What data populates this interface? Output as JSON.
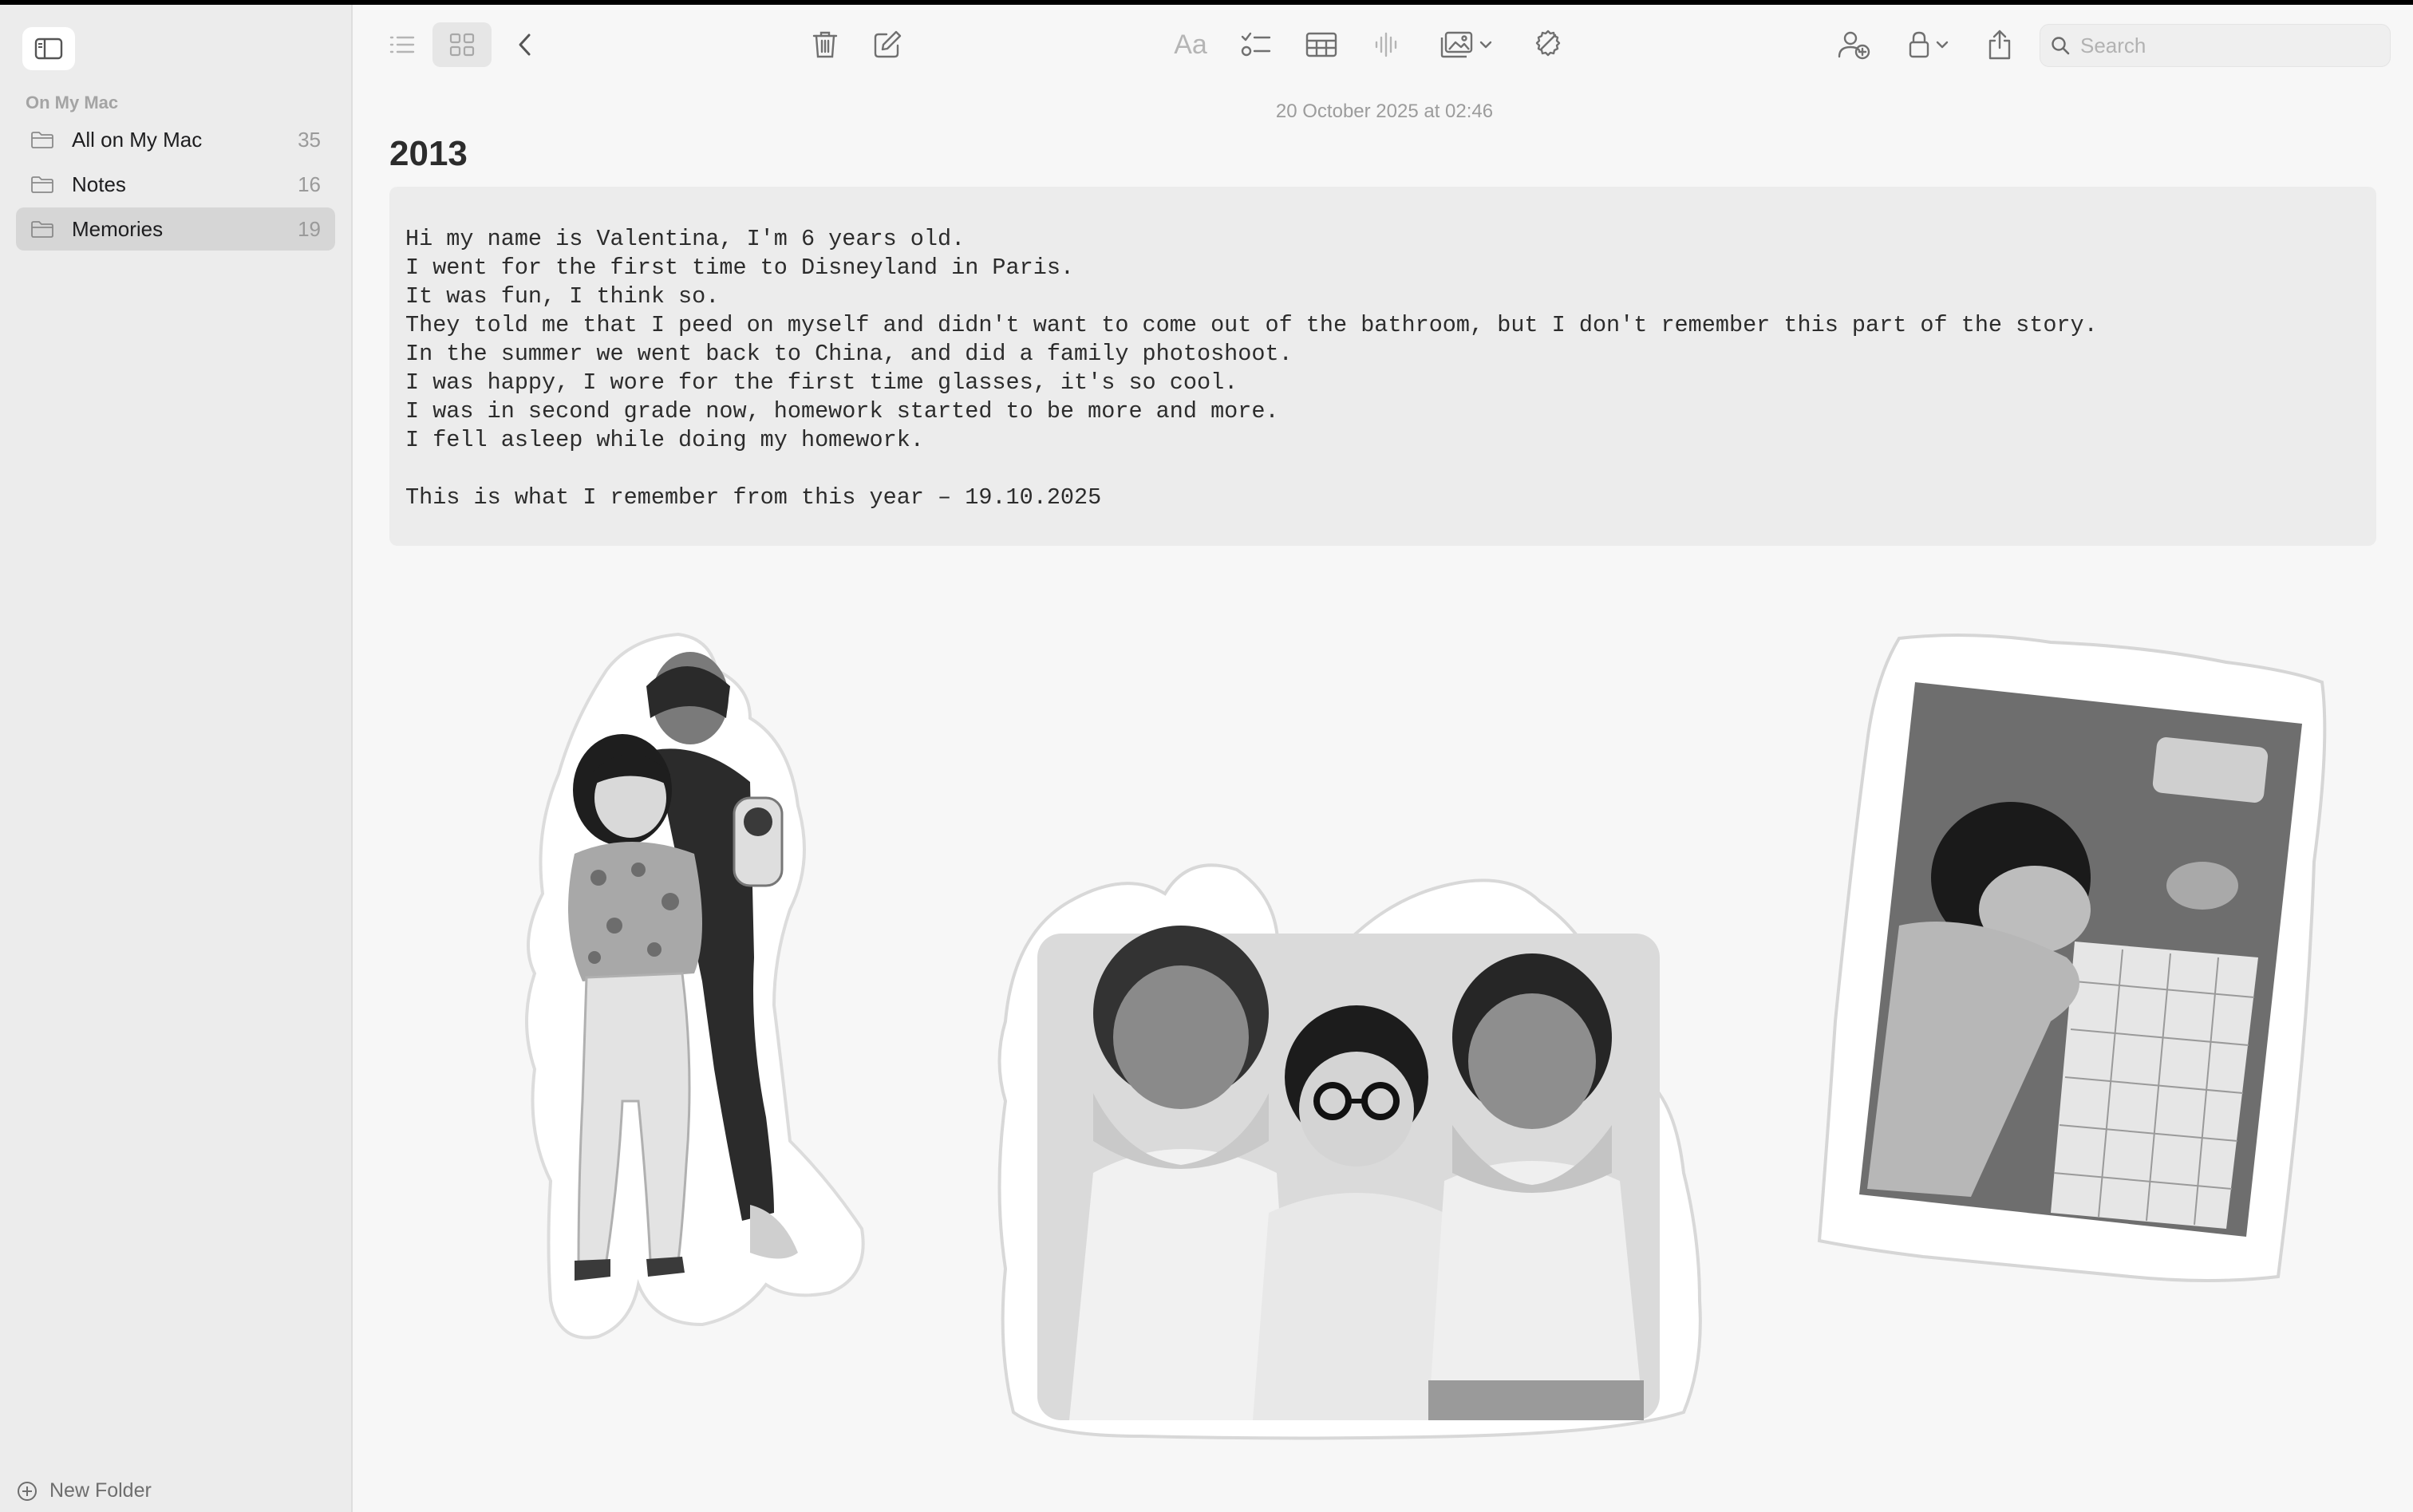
{
  "sidebar": {
    "section_title": "On My Mac",
    "folders": [
      {
        "name": "All on My Mac",
        "count": "35",
        "selected": false
      },
      {
        "name": "Notes",
        "count": "16",
        "selected": false
      },
      {
        "name": "Memories",
        "count": "19",
        "selected": true
      }
    ],
    "new_folder_label": "New Folder"
  },
  "toolbar": {
    "icons": [
      "sidebar-toggle-icon",
      "list-view-icon",
      "gallery-view-icon",
      "back-chevron-icon",
      "trash-icon",
      "compose-icon",
      "format-text-icon",
      "checklist-icon",
      "table-icon",
      "audio-waveform-icon",
      "media-icon",
      "writing-tools-icon",
      "collaborate-icon",
      "lock-icon",
      "share-icon"
    ],
    "format_label": "Aa",
    "search_placeholder": "Search"
  },
  "note": {
    "date": "20 October 2025 at 02:46",
    "title": "2013",
    "lines": [
      "Hi my name is Valentina, I'm 6 years old.",
      "I went for the first time to Disneyland in Paris.",
      "It was fun, I think so.",
      "They told me that I peed on myself and didn't want to come out of the bathroom, but I don't remember this part of the story.",
      "In the summer we went back to China, and did a family photoshoot.",
      "I was happy, I wore for the first time glasses, it's so cool.",
      "I was in second grade now, homework started to be more and more.",
      "I fell asleep while doing my homework.",
      "",
      "This is what I remember from this year – 19.10.2025"
    ]
  },
  "colors": {
    "sidebar_bg": "#ececec",
    "selected_folder_bg": "#d6d6d6",
    "note_bg": "#f7f7f7",
    "codeblock_bg": "#ececec"
  }
}
